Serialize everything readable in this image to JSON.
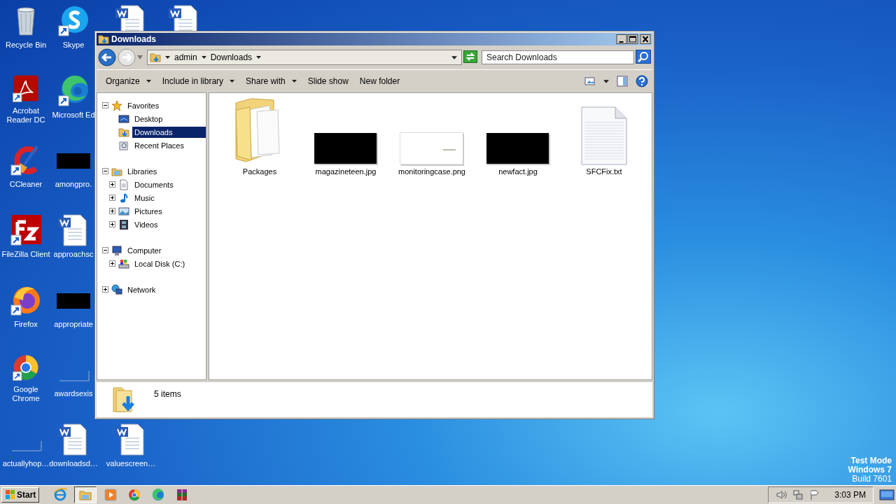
{
  "desktop": {
    "columns": [
      [
        {
          "label": "Recycle Bin",
          "kind": "trash",
          "shortcut": false
        },
        {
          "label": "Acrobat Reader DC",
          "kind": "pdf",
          "shortcut": true
        },
        {
          "label": "CCleaner",
          "kind": "broom",
          "shortcut": true
        },
        {
          "label": "FileZilla Client",
          "kind": "zilla",
          "shortcut": true
        },
        {
          "label": "Firefox",
          "kind": "fox",
          "shortcut": true
        },
        {
          "label": "Google Chrome",
          "kind": "ring",
          "shortcut": true
        },
        {
          "label": "actuallyhop…",
          "kind": "blank-thumb",
          "shortcut": false
        }
      ],
      [
        {
          "label": "Skype",
          "kind": "chat",
          "shortcut": true
        },
        {
          "label": "Microsoft Ed",
          "kind": "wave",
          "shortcut": true
        },
        {
          "label": "amongpro.",
          "kind": "dark-thumb",
          "shortcut": false
        },
        {
          "label": "approachsc",
          "kind": "word",
          "shortcut": false
        },
        {
          "label": "appropriate",
          "kind": "dark-thumb",
          "shortcut": false
        },
        {
          "label": "awardsexis",
          "kind": "blank-thumb",
          "shortcut": false
        },
        {
          "label": "downloadsd…",
          "kind": "word",
          "shortcut": false
        }
      ],
      [
        {
          "kind": "word",
          "shortcut": false
        },
        {
          "label": "valuescreen…",
          "kind": "word",
          "shortcut": false
        }
      ],
      [
        {
          "kind": "word",
          "shortcut": false
        }
      ]
    ],
    "notice": [
      "Test Mode",
      "Windows 7",
      "Build 7601"
    ]
  },
  "window": {
    "title": "Downloads",
    "address": {
      "crumbs": [
        "admin",
        "Downloads"
      ]
    },
    "search": {
      "placeholder": "Search Downloads"
    },
    "toolbar": [
      {
        "label": "Organize",
        "dropdown": true
      },
      {
        "label": "Include in library",
        "dropdown": true
      },
      {
        "label": "Share with",
        "dropdown": true
      },
      {
        "label": "Slide show",
        "dropdown": false
      },
      {
        "label": "New folder",
        "dropdown": false
      }
    ],
    "navigation": [
      {
        "label": "Favorites",
        "expanded": true,
        "children": [
          {
            "label": "Desktop",
            "selected": false
          },
          {
            "label": "Downloads",
            "selected": true
          },
          {
            "label": "Recent Places",
            "selected": false
          }
        ]
      },
      {
        "label": "Libraries",
        "expanded": true,
        "children": [
          {
            "label": "Documents",
            "expanded": false,
            "selected": false
          },
          {
            "label": "Music",
            "expanded": false,
            "selected": false
          },
          {
            "label": "Pictures",
            "expanded": false,
            "selected": false
          },
          {
            "label": "Videos",
            "expanded": false,
            "selected": false
          }
        ]
      },
      {
        "label": "Computer",
        "expanded": true,
        "children": [
          {
            "label": "Local Disk (C:)",
            "expanded": false,
            "selected": false
          }
        ]
      },
      {
        "label": "Network",
        "expanded": false
      }
    ],
    "files": [
      {
        "name": "Packages",
        "kind": "folder"
      },
      {
        "name": "magazineteen.jpg",
        "kind": "dark-image"
      },
      {
        "name": "monitoringcase.png",
        "kind": "light-image"
      },
      {
        "name": "newfact.jpg",
        "kind": "dark-image"
      },
      {
        "name": "SFCFix.txt",
        "kind": "text"
      }
    ],
    "status": "5 items"
  },
  "taskbar": {
    "start": "Start",
    "apps": [
      {
        "kind": "ie",
        "active": false
      },
      {
        "kind": "explorer",
        "active": true
      },
      {
        "kind": "media",
        "active": false
      },
      {
        "kind": "ring",
        "active": false
      },
      {
        "kind": "wave",
        "active": false
      },
      {
        "kind": "archive",
        "active": false
      }
    ],
    "clock": "3:03 PM"
  }
}
